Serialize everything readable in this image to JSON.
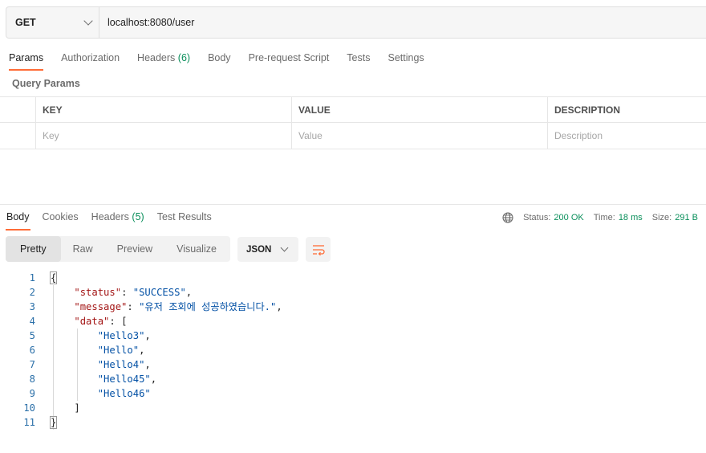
{
  "request": {
    "method": "GET",
    "url": "localhost:8080/user"
  },
  "request_tabs": [
    {
      "label": "Params",
      "count": ""
    },
    {
      "label": "Authorization",
      "count": ""
    },
    {
      "label": "Headers",
      "count": "(6)"
    },
    {
      "label": "Body",
      "count": ""
    },
    {
      "label": "Pre-request Script",
      "count": ""
    },
    {
      "label": "Tests",
      "count": ""
    },
    {
      "label": "Settings",
      "count": ""
    }
  ],
  "query_params": {
    "title": "Query Params",
    "headers": {
      "key": "KEY",
      "value": "VALUE",
      "description": "DESCRIPTION"
    },
    "placeholders": {
      "key": "Key",
      "value": "Value",
      "description": "Description"
    }
  },
  "response_tabs": [
    {
      "label": "Body",
      "count": ""
    },
    {
      "label": "Cookies",
      "count": ""
    },
    {
      "label": "Headers",
      "count": "(5)"
    },
    {
      "label": "Test Results",
      "count": ""
    }
  ],
  "response_meta": {
    "status_label": "Status:",
    "status_value": "200 OK",
    "time_label": "Time:",
    "time_value": "18 ms",
    "size_label": "Size:",
    "size_value": "291 B"
  },
  "view_modes": [
    "Pretty",
    "Raw",
    "Preview",
    "Visualize"
  ],
  "format": "JSON",
  "line_numbers": [
    "1",
    "2",
    "3",
    "4",
    "5",
    "6",
    "7",
    "8",
    "9",
    "10",
    "11"
  ],
  "response_body": {
    "status_key": "\"status\"",
    "status_value": "\"SUCCESS\"",
    "message_key": "\"message\"",
    "message_value": "\"유저 조회에 성공하였습니다.\"",
    "data_key": "\"data\"",
    "data_items": [
      "\"Hello3\"",
      "\"Hello\"",
      "\"Hello4\"",
      "\"Hello45\"",
      "\"Hello46\""
    ]
  },
  "colors": {
    "accent": "#ff6c37",
    "success": "#0a8f5b",
    "json_key": "#a31515",
    "json_string": "#0451a5",
    "line_number": "#2a6fa8"
  }
}
